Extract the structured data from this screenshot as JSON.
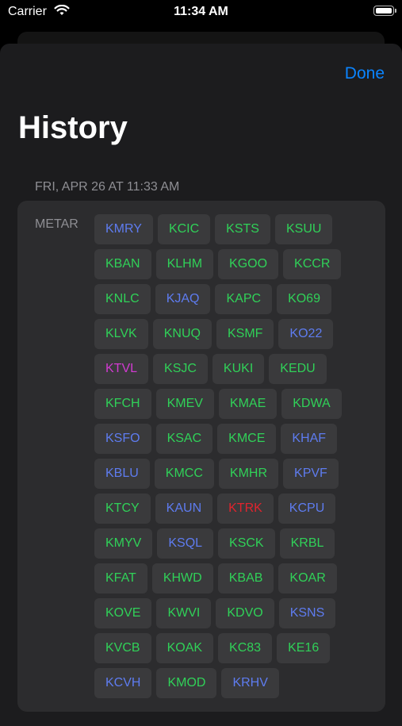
{
  "status_bar": {
    "carrier": "Carrier",
    "time": "11:34 AM"
  },
  "header": {
    "done_label": "Done",
    "title": "History"
  },
  "section": {
    "header": "FRI, APR 26 AT 11:33 AM"
  },
  "metar": {
    "label": "METAR"
  },
  "colors": {
    "green": "#30d158",
    "blue": "#5e7cf0",
    "magenta": "#d13ad1",
    "red": "#e0242d",
    "accent": "#0a84ff"
  },
  "stations": [
    [
      {
        "code": "KMRY",
        "status": "blue"
      },
      {
        "code": "KCIC",
        "status": "green"
      },
      {
        "code": "KSTS",
        "status": "green"
      },
      {
        "code": "KSUU",
        "status": "green"
      }
    ],
    [
      {
        "code": "KBAN",
        "status": "green"
      },
      {
        "code": "KLHM",
        "status": "green"
      },
      {
        "code": "KGOO",
        "status": "green"
      },
      {
        "code": "KCCR",
        "status": "green"
      }
    ],
    [
      {
        "code": "KNLC",
        "status": "green"
      },
      {
        "code": "KJAQ",
        "status": "blue"
      },
      {
        "code": "KAPC",
        "status": "green"
      },
      {
        "code": "KO69",
        "status": "green"
      }
    ],
    [
      {
        "code": "KLVK",
        "status": "green"
      },
      {
        "code": "KNUQ",
        "status": "green"
      },
      {
        "code": "KSMF",
        "status": "green"
      },
      {
        "code": "KO22",
        "status": "blue"
      }
    ],
    [
      {
        "code": "KTVL",
        "status": "magenta"
      },
      {
        "code": "KSJC",
        "status": "green"
      },
      {
        "code": "KUKI",
        "status": "green"
      },
      {
        "code": "KEDU",
        "status": "green"
      }
    ],
    [
      {
        "code": "KFCH",
        "status": "green"
      },
      {
        "code": "KMEV",
        "status": "green"
      },
      {
        "code": "KMAE",
        "status": "green"
      },
      {
        "code": "KDWA",
        "status": "green"
      }
    ],
    [
      {
        "code": "KSFO",
        "status": "blue"
      },
      {
        "code": "KSAC",
        "status": "green"
      },
      {
        "code": "KMCE",
        "status": "green"
      },
      {
        "code": "KHAF",
        "status": "blue"
      }
    ],
    [
      {
        "code": "KBLU",
        "status": "blue"
      },
      {
        "code": "KMCC",
        "status": "green"
      },
      {
        "code": "KMHR",
        "status": "green"
      },
      {
        "code": "KPVF",
        "status": "blue"
      }
    ],
    [
      {
        "code": "KTCY",
        "status": "green"
      },
      {
        "code": "KAUN",
        "status": "blue"
      },
      {
        "code": "KTRK",
        "status": "red"
      },
      {
        "code": "KCPU",
        "status": "blue"
      }
    ],
    [
      {
        "code": "KMYV",
        "status": "green"
      },
      {
        "code": "KSQL",
        "status": "blue"
      },
      {
        "code": "KSCK",
        "status": "green"
      },
      {
        "code": "KRBL",
        "status": "green"
      }
    ],
    [
      {
        "code": "KFAT",
        "status": "green"
      },
      {
        "code": "KHWD",
        "status": "green"
      },
      {
        "code": "KBAB",
        "status": "green"
      },
      {
        "code": "KOAR",
        "status": "green"
      }
    ],
    [
      {
        "code": "KOVE",
        "status": "green"
      },
      {
        "code": "KWVI",
        "status": "green"
      },
      {
        "code": "KDVO",
        "status": "green"
      },
      {
        "code": "KSNS",
        "status": "blue"
      }
    ],
    [
      {
        "code": "KVCB",
        "status": "green"
      },
      {
        "code": "KOAK",
        "status": "green"
      },
      {
        "code": "KC83",
        "status": "green"
      },
      {
        "code": "KE16",
        "status": "green"
      }
    ],
    [
      {
        "code": "KCVH",
        "status": "blue"
      },
      {
        "code": "KMOD",
        "status": "green"
      },
      {
        "code": "KRHV",
        "status": "blue"
      }
    ]
  ]
}
